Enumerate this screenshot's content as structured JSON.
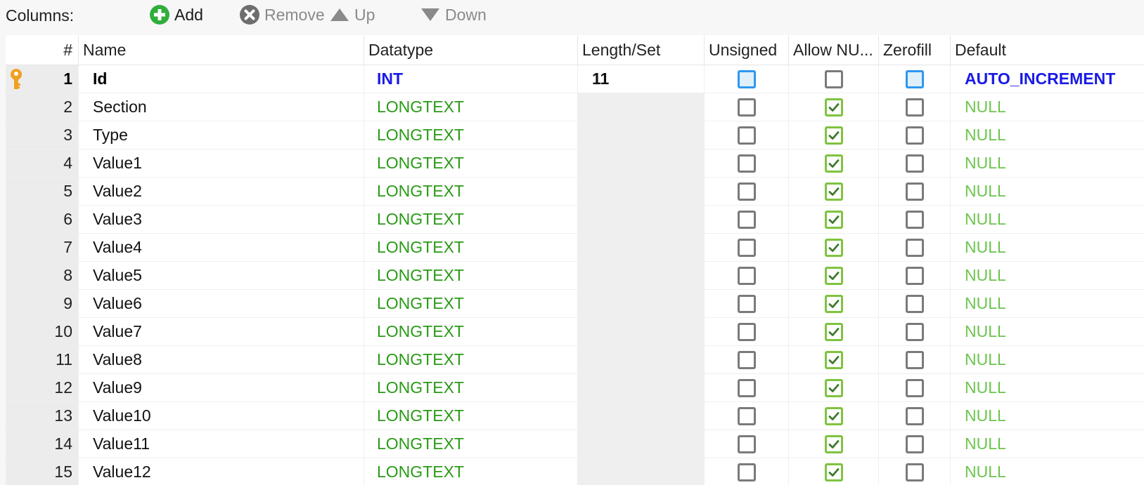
{
  "toolbar": {
    "label": "Columns:",
    "add_label": "Add",
    "remove_label": "Remove",
    "up_label": "Up",
    "down_label": "Down"
  },
  "headers": {
    "num": "#",
    "name": "Name",
    "datatype": "Datatype",
    "length": "Length/Set",
    "unsigned": "Unsigned",
    "allow_null": "Allow NU...",
    "zerofill": "Zerofill",
    "default": "Default"
  },
  "colors": {
    "key_icon": "#f0a020",
    "longtext_green": "#2a9a17",
    "null_green": "#6cc54f",
    "primary_blue": "#1a1ae6",
    "checkbox_checked": "#7fc33f",
    "checkbox_blue": "#2e97f0"
  },
  "rows": [
    {
      "num": "1",
      "name": "Id",
      "datatype": "INT",
      "length": "11",
      "unsigned": false,
      "allow_null": false,
      "zerofill": false,
      "default": "AUTO_INCREMENT",
      "primary": true,
      "icon": "key-icon"
    },
    {
      "num": "2",
      "name": "Section",
      "datatype": "LONGTEXT",
      "length": "",
      "unsigned": false,
      "allow_null": true,
      "zerofill": false,
      "default": "NULL"
    },
    {
      "num": "3",
      "name": "Type",
      "datatype": "LONGTEXT",
      "length": "",
      "unsigned": false,
      "allow_null": true,
      "zerofill": false,
      "default": "NULL"
    },
    {
      "num": "4",
      "name": "Value1",
      "datatype": "LONGTEXT",
      "length": "",
      "unsigned": false,
      "allow_null": true,
      "zerofill": false,
      "default": "NULL"
    },
    {
      "num": "5",
      "name": "Value2",
      "datatype": "LONGTEXT",
      "length": "",
      "unsigned": false,
      "allow_null": true,
      "zerofill": false,
      "default": "NULL"
    },
    {
      "num": "6",
      "name": "Value3",
      "datatype": "LONGTEXT",
      "length": "",
      "unsigned": false,
      "allow_null": true,
      "zerofill": false,
      "default": "NULL"
    },
    {
      "num": "7",
      "name": "Value4",
      "datatype": "LONGTEXT",
      "length": "",
      "unsigned": false,
      "allow_null": true,
      "zerofill": false,
      "default": "NULL"
    },
    {
      "num": "8",
      "name": "Value5",
      "datatype": "LONGTEXT",
      "length": "",
      "unsigned": false,
      "allow_null": true,
      "zerofill": false,
      "default": "NULL"
    },
    {
      "num": "9",
      "name": "Value6",
      "datatype": "LONGTEXT",
      "length": "",
      "unsigned": false,
      "allow_null": true,
      "zerofill": false,
      "default": "NULL"
    },
    {
      "num": "10",
      "name": "Value7",
      "datatype": "LONGTEXT",
      "length": "",
      "unsigned": false,
      "allow_null": true,
      "zerofill": false,
      "default": "NULL"
    },
    {
      "num": "11",
      "name": "Value8",
      "datatype": "LONGTEXT",
      "length": "",
      "unsigned": false,
      "allow_null": true,
      "zerofill": false,
      "default": "NULL"
    },
    {
      "num": "12",
      "name": "Value9",
      "datatype": "LONGTEXT",
      "length": "",
      "unsigned": false,
      "allow_null": true,
      "zerofill": false,
      "default": "NULL"
    },
    {
      "num": "13",
      "name": "Value10",
      "datatype": "LONGTEXT",
      "length": "",
      "unsigned": false,
      "allow_null": true,
      "zerofill": false,
      "default": "NULL"
    },
    {
      "num": "14",
      "name": "Value11",
      "datatype": "LONGTEXT",
      "length": "",
      "unsigned": false,
      "allow_null": true,
      "zerofill": false,
      "default": "NULL"
    },
    {
      "num": "15",
      "name": "Value12",
      "datatype": "LONGTEXT",
      "length": "",
      "unsigned": false,
      "allow_null": true,
      "zerofill": false,
      "default": "NULL"
    }
  ]
}
